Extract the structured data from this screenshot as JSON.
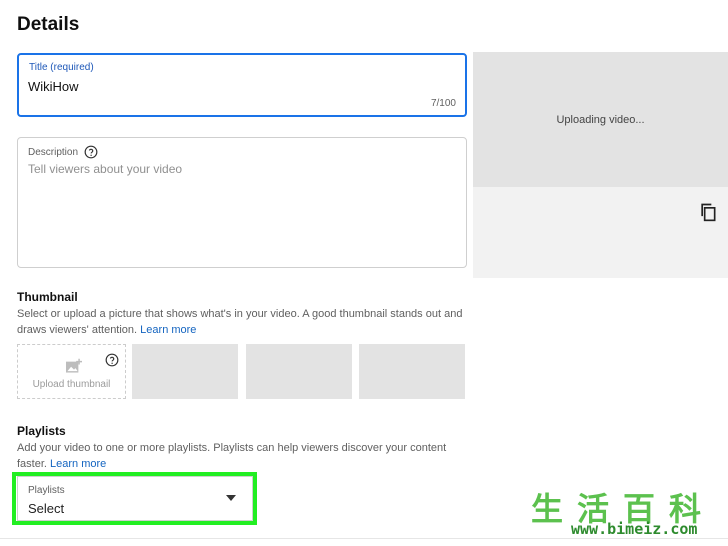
{
  "page": {
    "heading": "Details"
  },
  "title_field": {
    "label": "Title (required)",
    "value": "WikiHow",
    "counter": "7/100"
  },
  "description_field": {
    "label": "Description",
    "placeholder": "Tell viewers about your video",
    "help_icon": "question-circle-icon"
  },
  "preview": {
    "status": "Uploading video...",
    "copy_icon": "copy-icon"
  },
  "thumbnail": {
    "title": "Thumbnail",
    "text": "Select or upload a picture that shows what's in your video. A good thumbnail stands out and draws viewers' attention.",
    "link": "Learn more",
    "upload_label": "Upload thumbnail",
    "upload_icon": "add-image-icon"
  },
  "playlists": {
    "title": "Playlists",
    "text": "Add your video to one or more playlists. Playlists can help viewers discover your content faster.",
    "link": "Learn more",
    "select_label": "Playlists",
    "select_value": "Select",
    "highlight_color": "#22ee22"
  },
  "watermark": {
    "chars": "生活百科",
    "url": "www.bimeiz.com"
  },
  "colors": {
    "accent": "#1a73e8",
    "link": "#1565c0",
    "placeholder": "#e3e3e3"
  }
}
